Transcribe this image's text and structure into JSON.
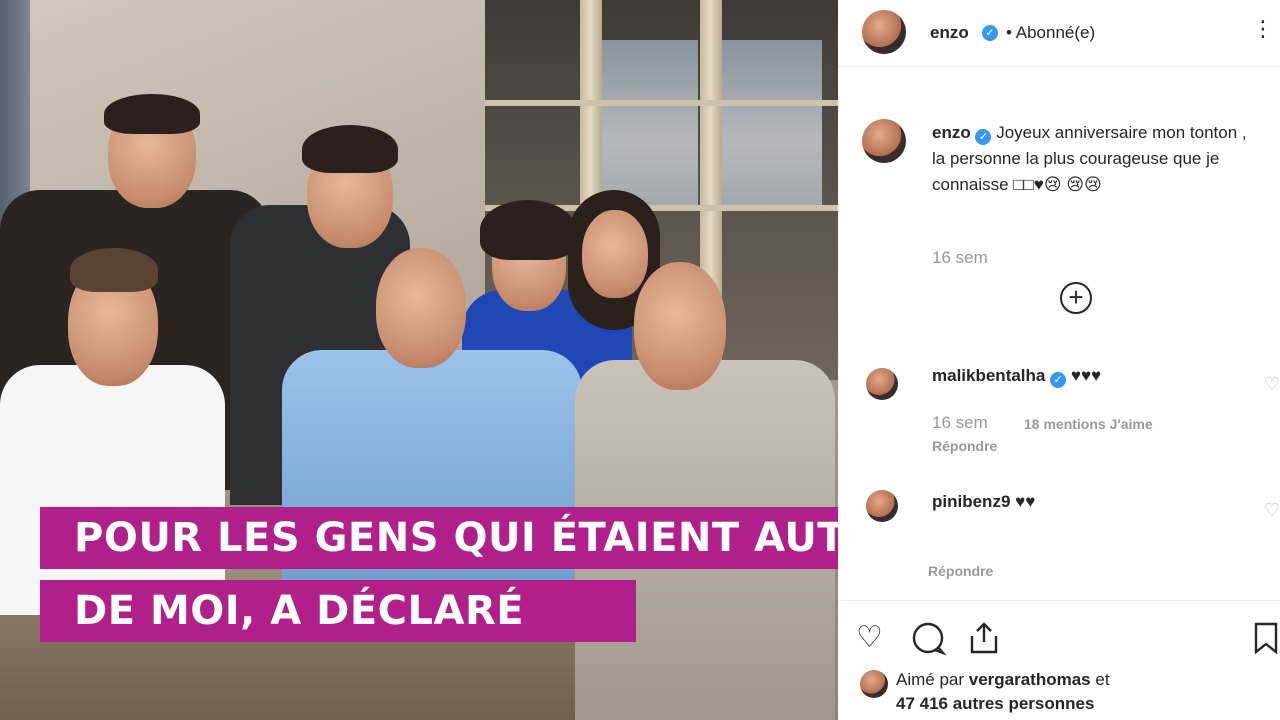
{
  "post": {
    "username": "enzo",
    "follow_status": "• Abonné(e)",
    "caption_username": "enzo",
    "caption_text": "Joyeux anniversaire mon tonton , la personne la plus courageuse que je connaisse □□♥😢 😢😢",
    "caption_time": "16 sem",
    "load_more_icon": "plus-circle-icon"
  },
  "comments": [
    {
      "username": "malikbentalha",
      "text": "♥♥♥",
      "time": "16 sem",
      "likes": "18 mentions J'aime",
      "reply": "Répondre"
    },
    {
      "username": "pinibenz9",
      "text": "♥♥",
      "reply": "Répondre"
    }
  ],
  "actions": {
    "like_icon": "heart-icon",
    "comment_icon": "comment-icon",
    "share_icon": "share-icon",
    "save_icon": "bookmark-icon"
  },
  "likes_summary": {
    "prefix": "Aimé par ",
    "user": "vergarathomas",
    "connector": " et",
    "others": "47 416 autres personnes"
  },
  "overlay_caption": {
    "line1": "POUR LES GENS QUI ÉTAIENT AUTOUR",
    "line2": "DE MOI, A DÉCLARÉ"
  },
  "colors": {
    "caption_background": "#b1208a",
    "verified_badge": "#3897f0"
  }
}
